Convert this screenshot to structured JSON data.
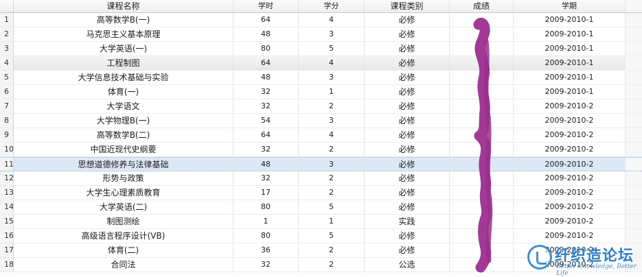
{
  "headers": [
    "课程名称",
    "学时",
    "学分",
    "课程类别",
    "成绩",
    "学期"
  ],
  "rows": [
    {
      "idx": "1",
      "name": "高等数学B(一)",
      "hours": "64",
      "credits": "4",
      "type": "必修",
      "grade": "",
      "term": "2009-2010-1"
    },
    {
      "idx": "2",
      "name": "马克思主义基本原理",
      "hours": "48",
      "credits": "3",
      "type": "必修",
      "grade": "",
      "term": "2009-2010-1"
    },
    {
      "idx": "3",
      "name": "大学英语(一)",
      "hours": "80",
      "credits": "5",
      "type": "必修",
      "grade": "",
      "term": "2009-2010-1"
    },
    {
      "idx": "4",
      "name": "工程制图",
      "hours": "64",
      "credits": "4",
      "type": "必修",
      "grade": "",
      "term": "2009-2010-1"
    },
    {
      "idx": "5",
      "name": "大学信息技术基础与实验",
      "hours": "48",
      "credits": "3",
      "type": "必修",
      "grade": "",
      "term": "2009-2010-1"
    },
    {
      "idx": "6",
      "name": "体育(一)",
      "hours": "32",
      "credits": "1",
      "type": "必修",
      "grade": "",
      "term": "2009-2010-1"
    },
    {
      "idx": "7",
      "name": "大学语文",
      "hours": "32",
      "credits": "2",
      "type": "必修",
      "grade": "",
      "term": "2009-2010-2"
    },
    {
      "idx": "8",
      "name": "大学物理B(一)",
      "hours": "54",
      "credits": "3",
      "type": "必修",
      "grade": "",
      "term": "2009-2010-2"
    },
    {
      "idx": "9",
      "name": "高等数学B(二)",
      "hours": "64",
      "credits": "4",
      "type": "必修",
      "grade": "",
      "term": "2009-2010-2"
    },
    {
      "idx": "10",
      "name": "中国近现代史纲要",
      "hours": "32",
      "credits": "2",
      "type": "必修",
      "grade": "",
      "term": "2009-2010-2"
    },
    {
      "idx": "11",
      "name": "思想道德修养与法律基础",
      "hours": "48",
      "credits": "3",
      "type": "必修",
      "grade": "",
      "term": "2009-2010-2"
    },
    {
      "idx": "12",
      "name": "形势与政策",
      "hours": "32",
      "credits": "2",
      "type": "必修",
      "grade": "",
      "term": "2009-2010-2"
    },
    {
      "idx": "13",
      "name": "大学生心理素质教育",
      "hours": "17",
      "credits": "2",
      "type": "必修",
      "grade": "",
      "term": "2009-2010-2"
    },
    {
      "idx": "14",
      "name": "大学英语(二)",
      "hours": "80",
      "credits": "5",
      "type": "必修",
      "grade": "",
      "term": "2009-2010-2"
    },
    {
      "idx": "15",
      "name": "制图测绘",
      "hours": "1",
      "credits": "1",
      "type": "实践",
      "grade": "",
      "term": "2009-2010-2"
    },
    {
      "idx": "16",
      "name": "高级语言程序设计(VB)",
      "hours": "80",
      "credits": "5",
      "type": "必修",
      "grade": "",
      "term": "2009-2010-2"
    },
    {
      "idx": "17",
      "name": "体育(二)",
      "hours": "36",
      "credits": "2",
      "type": "必修",
      "grade": "",
      "term": "2009-2010-2"
    },
    {
      "idx": "18",
      "name": "合同法",
      "hours": "32",
      "credits": "2",
      "type": "公选",
      "grade": "",
      "term": "2009-2010-2"
    }
  ],
  "watermark": {
    "title": "纤织造论坛",
    "subtitle": "Better Knowledge, Better Life"
  },
  "colors": {
    "scribble": "#9b2f8f",
    "selected_blue": "#dde8f6",
    "watermark_blue": "#2f7fc8"
  }
}
